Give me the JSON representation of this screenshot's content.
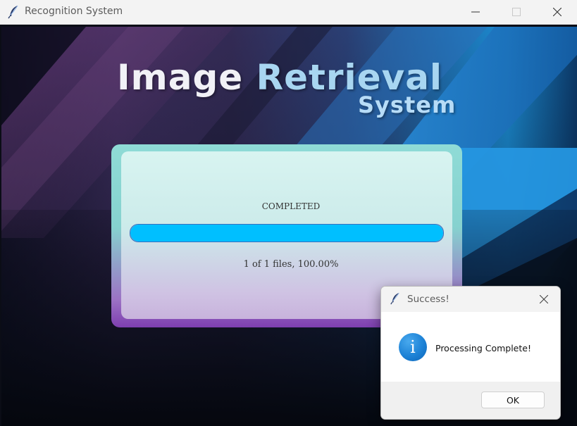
{
  "window": {
    "title": "Recognition System",
    "app_icon": "feather-icon",
    "controls": [
      "minimize-icon",
      "maximize-icon",
      "close-icon"
    ]
  },
  "header": {
    "title_part1": "Image",
    "title_part2": "Retrieval",
    "subtitle": "System"
  },
  "progress_panel": {
    "status": "COMPLETED",
    "progress_fraction": 1.0,
    "files_text": "1 of 1 files, 100.00%"
  },
  "dialog": {
    "title": "Success!",
    "icon": "info-icon",
    "icon_glyph": "i",
    "message": "Processing Complete!",
    "ok_label": "OK"
  },
  "colors": {
    "progress_fill": "#00bfff",
    "title_white": "#f1f1f6",
    "title_blue": "#a8d6f1",
    "info_blue": "#1d82d6"
  }
}
